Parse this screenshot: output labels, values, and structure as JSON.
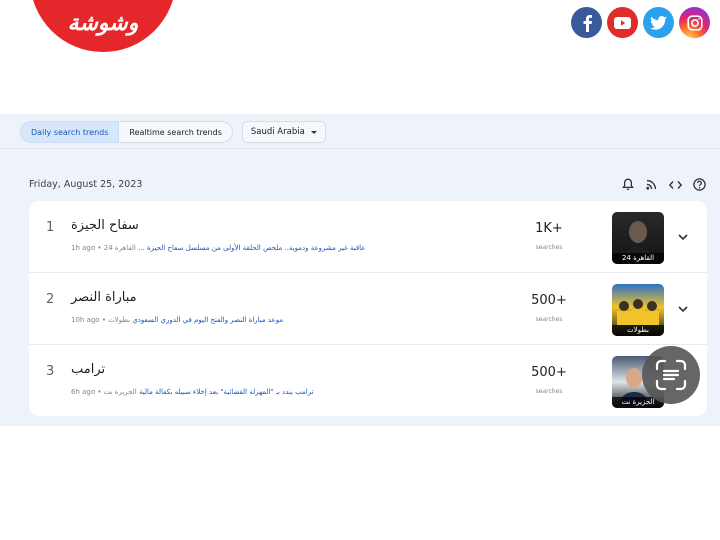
{
  "brand": {
    "name": "وشوشة",
    "color": "#e5262a"
  },
  "social": [
    {
      "name": "facebook-icon",
      "color": "#3b5a9a"
    },
    {
      "name": "youtube-icon",
      "color": "#e12d2a"
    },
    {
      "name": "twitter-icon",
      "color": "#2aa3ef"
    },
    {
      "name": "instagram-icon",
      "color": "#c13584"
    }
  ],
  "tabs": {
    "daily": "Daily search trends",
    "realtime": "Realtime search trends",
    "active": "daily"
  },
  "region": {
    "selected": "Saudi Arabia"
  },
  "date": "Friday, August 25, 2023",
  "tools": [
    "bell-icon",
    "rss-icon",
    "embed-code-icon",
    "help-icon"
  ],
  "trends": [
    {
      "rank": "1",
      "title": "سفاح الجيزة",
      "source": "القاهرة 24",
      "time": "1h ago",
      "snippet": "عاقبة غير مشروعة ودموية.. ملخص الحلقة الأولى من مسلسل سفاح الجيزة ...",
      "count": "1K+",
      "count_label": "searches",
      "thumb_caption": "القاهرة 24"
    },
    {
      "rank": "2",
      "title": "مباراة النصر",
      "source": "بطولات",
      "time": "10h ago",
      "snippet": "موعد مباراة النصر والفتح اليوم في الدوري السعودي",
      "count": "500+",
      "count_label": "searches",
      "thumb_caption": "بطولات"
    },
    {
      "rank": "3",
      "title": "ترامب",
      "source": "الجزيرة نت",
      "time": "6h ago",
      "snippet": "ترامب يندد بـ \"المهزلة القضائية\" بعد إخلاء سبيله بكفالة مالية",
      "count": "500+",
      "count_label": "searches",
      "thumb_caption": "الجزيرة نت"
    }
  ]
}
